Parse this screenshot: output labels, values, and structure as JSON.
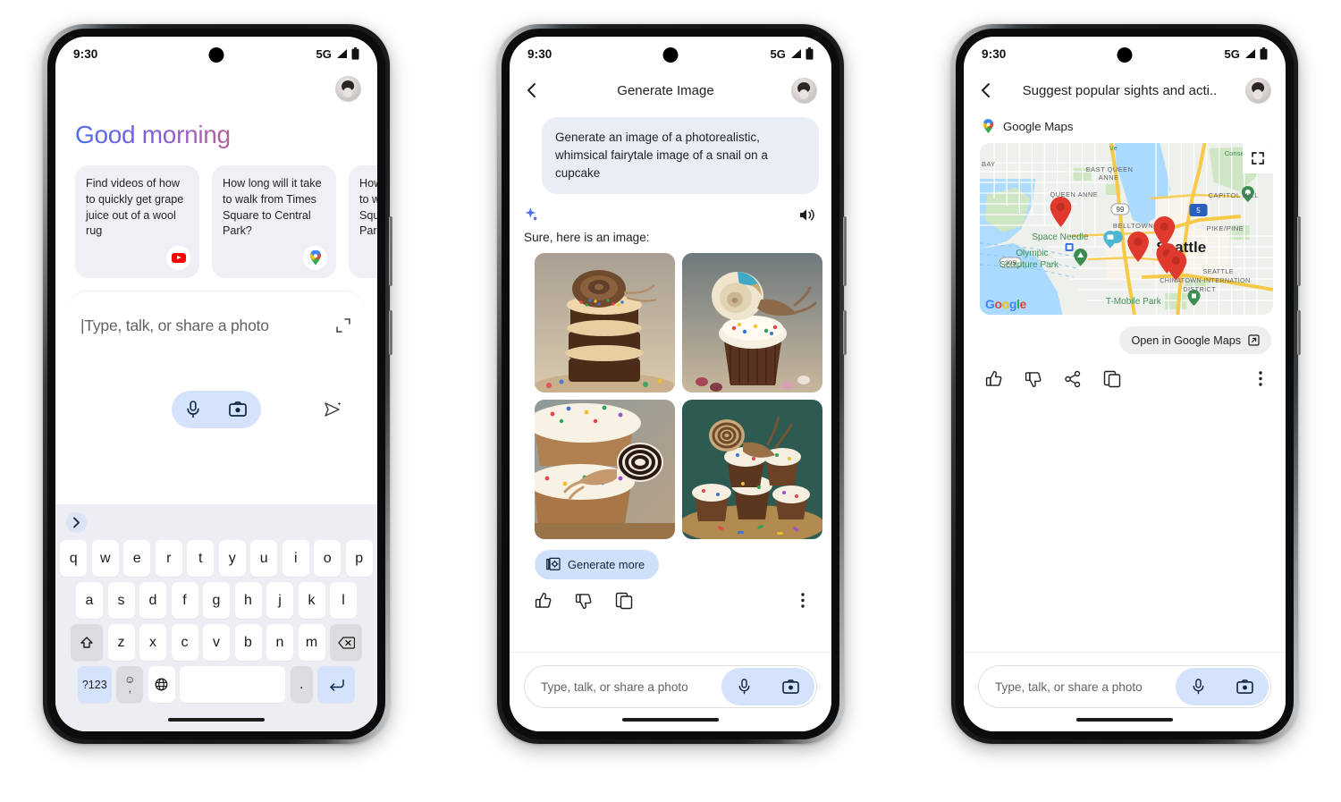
{
  "status_bar": {
    "time": "9:30",
    "network": "5G"
  },
  "phone1": {
    "greeting": "Good morning",
    "suggestions": [
      {
        "text": "Find videos of how to quickly get grape juice out of a wool rug",
        "icon": "youtube-icon"
      },
      {
        "text": "How long will it take to walk from Times Square to Central Park?",
        "icon": "google-maps-icon"
      },
      {
        "text": "How long will it take to walk from Times Square to Central Park?",
        "icon": "google-maps-icon"
      }
    ],
    "composer": {
      "placeholder": "|Type, talk, or share a photo",
      "expand_icon": "expand-icon",
      "mic_icon": "microphone-icon",
      "camera_icon": "camera-icon",
      "send_icon": "send-sparkle-icon"
    },
    "keyboard": {
      "toolbar_icon": "chevron-right-icon",
      "row1": [
        "q",
        "w",
        "e",
        "r",
        "t",
        "y",
        "u",
        "i",
        "o",
        "p"
      ],
      "row2": [
        "a",
        "s",
        "d",
        "f",
        "g",
        "h",
        "j",
        "k",
        "l"
      ],
      "row3": [
        "z",
        "x",
        "c",
        "v",
        "b",
        "n",
        "m"
      ],
      "shift_icon": "shift-icon",
      "backspace_icon": "backspace-icon",
      "numeric_label": "?123",
      "emoji_label": "☺",
      "comma_label": ",",
      "globe_icon": "globe-icon",
      "space_label": "",
      "period_label": ".",
      "enter_icon": "enter-icon"
    }
  },
  "phone2": {
    "title": "Generate Image",
    "back_icon": "back-arrow-icon",
    "user_message": "Generate an image of a photorealistic, whimsical fairytale image of a snail on a cupcake",
    "sparkle_icon": "sparkle-icon",
    "speaker_icon": "speaker-icon",
    "ai_message": "Sure, here is an image:",
    "images": [
      {
        "alt": "snail-on-stacked-cupcakes"
      },
      {
        "alt": "snail-on-frosted-cupcake"
      },
      {
        "alt": "striped-snail-on-cupcakes"
      },
      {
        "alt": "snails-on-cupcake-platter"
      }
    ],
    "generate_more_label": "Generate more",
    "generate_more_icon": "generate-images-icon",
    "actions": [
      {
        "name": "thumbs-up-icon"
      },
      {
        "name": "thumbs-down-icon"
      },
      {
        "name": "copy-icon"
      }
    ],
    "kebab_icon": "more-vertical-icon",
    "composer": {
      "placeholder": "Type, talk, or share a photo",
      "mic_icon": "microphone-icon",
      "camera_icon": "camera-icon"
    }
  },
  "phone3": {
    "title": "Suggest popular sights and acti..",
    "back_icon": "back-arrow-icon",
    "source_label": "Google Maps",
    "source_icon": "google-maps-pin-icon",
    "map": {
      "fullscreen_icon": "fullscreen-icon",
      "attribution": "Google",
      "city_label": "Seattle",
      "labels": [
        "BAY",
        "EAST QUEEN ANNE",
        "QUEEN ANNE",
        "CAPITOL HILL",
        "Space Needle",
        "Olympic Sculpture Park",
        "BELLTOWN",
        "PIKE/PINE",
        "Seattle",
        "SEATTLE CHINATOWN-INTERNATION DISTRICT",
        "T-Mobile Park",
        "Conserva"
      ],
      "route_shields": [
        "99",
        "5",
        "305"
      ],
      "marker_count": 5
    },
    "open_maps_label": "Open in Google Maps",
    "open_maps_icon": "external-link-icon",
    "actions": [
      {
        "name": "thumbs-up-icon"
      },
      {
        "name": "thumbs-down-icon"
      },
      {
        "name": "share-icon"
      },
      {
        "name": "copy-icon"
      }
    ],
    "kebab_icon": "more-vertical-icon",
    "composer": {
      "placeholder": "Type, talk, or share a photo",
      "mic_icon": "microphone-icon",
      "camera_icon": "camera-icon"
    }
  },
  "colors": {
    "accent_blue": "#d4e2fc",
    "chip_blue": "#cfe0fb",
    "card_grey": "#eef0f5",
    "bubble_grey": "#e8edf6",
    "marker_red": "#e03a2f"
  }
}
